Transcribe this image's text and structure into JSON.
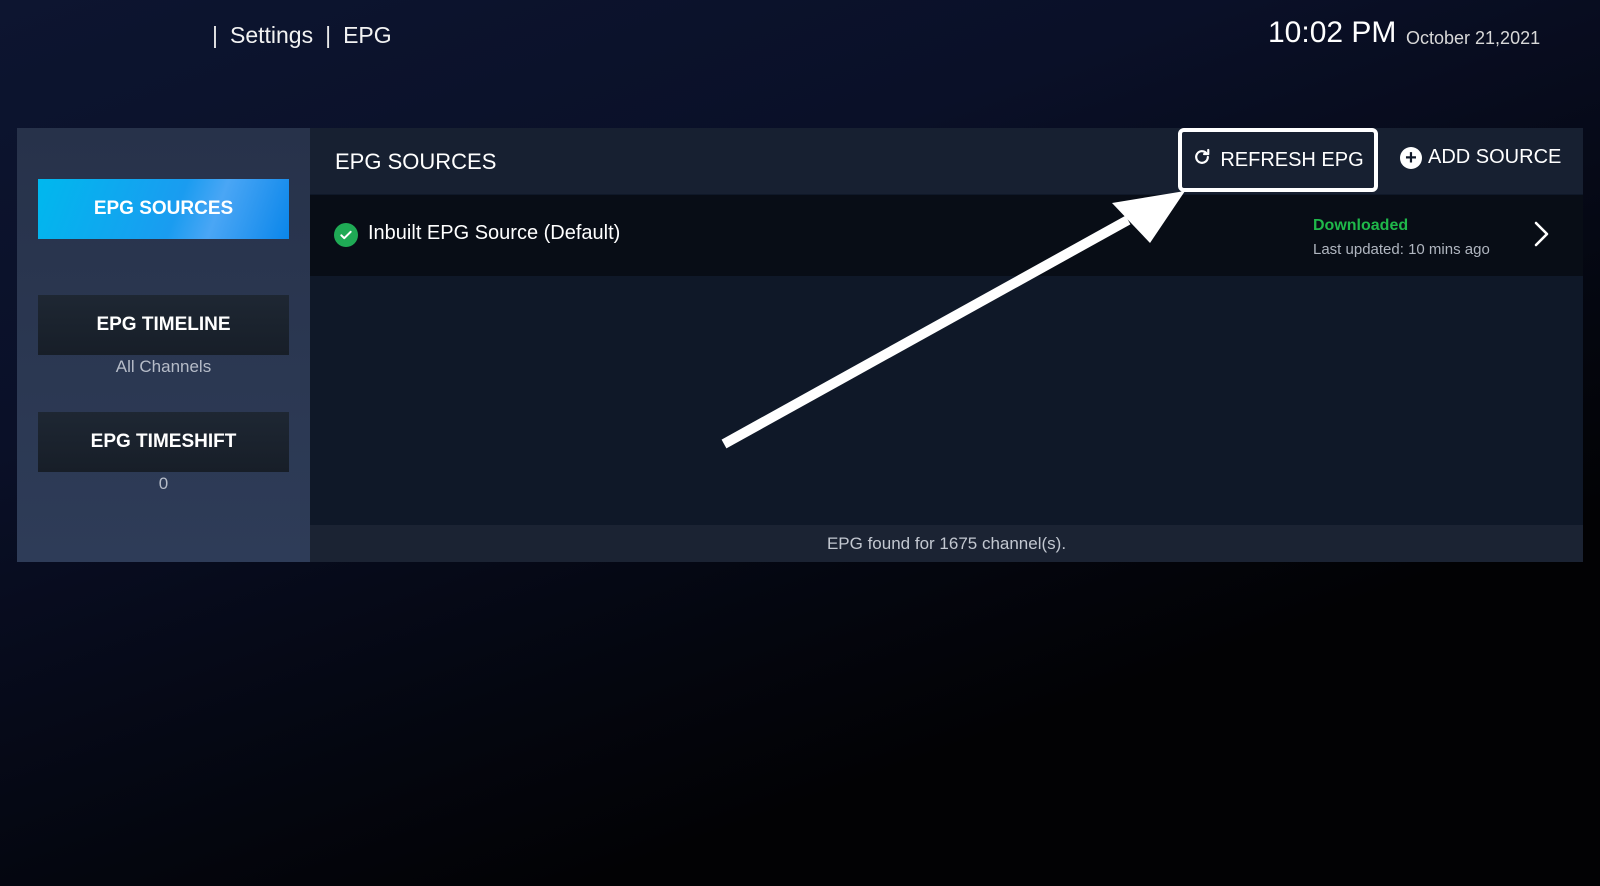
{
  "header": {
    "separator": "|",
    "breadcrumb": [
      "Settings",
      "EPG"
    ],
    "time": "10:02 PM",
    "date": "October 21,2021"
  },
  "sidebar": {
    "items": [
      {
        "label": "EPG SOURCES",
        "sub": "",
        "active": true
      },
      {
        "label": "EPG TIMELINE",
        "sub": "All Channels",
        "active": false
      },
      {
        "label": "EPG TIMESHIFT",
        "sub": "0",
        "active": false
      }
    ]
  },
  "main": {
    "title": "EPG SOURCES",
    "refresh_label": "REFRESH EPG",
    "add_label": "ADD SOURCE",
    "sources": [
      {
        "name": "Inbuilt EPG Source (Default)",
        "status": "Downloaded",
        "updated": "Last updated: 10 mins ago"
      }
    ],
    "footer": "EPG found for 1675 channel(s)."
  },
  "colors": {
    "accent": "#00b8ee",
    "status_ok": "#1fb84a",
    "check": "#1faa55"
  },
  "icons": {
    "refresh": "refresh-icon",
    "add": "plus-circle-icon",
    "check": "check-circle-icon",
    "chevron": "chevron-right-icon"
  }
}
